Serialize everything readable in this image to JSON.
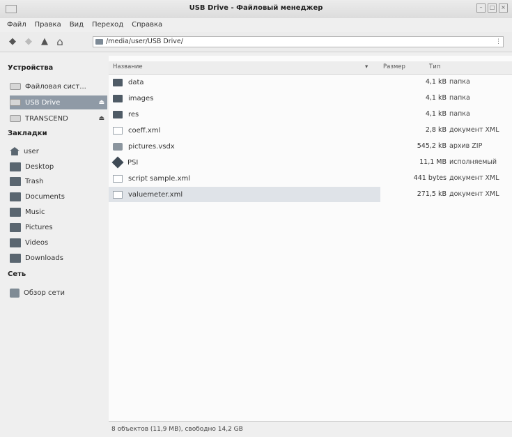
{
  "window": {
    "title": "USB Drive - Файловый менеджер"
  },
  "menu": [
    "Файл",
    "Правка",
    "Вид",
    "Переход",
    "Справка"
  ],
  "toolbar": {
    "path": "/media/user/USB Drive/",
    "icons": [
      "back-icon",
      "forward-icon",
      "up-icon",
      "home-icon"
    ]
  },
  "sidebar": {
    "devices_heading": "Устройства",
    "devices": [
      {
        "label": "Файловая сист...",
        "icon": "drive-icon"
      },
      {
        "label": "USB Drive",
        "icon": "drive-icon",
        "selected": true,
        "eject": "⏏"
      },
      {
        "label": "TRANSCEND",
        "icon": "drive-icon",
        "eject": "⏏"
      }
    ],
    "bookmarks_heading": "Закладки",
    "bookmarks": [
      {
        "label": "user",
        "icon": "home-icon"
      },
      {
        "label": "Desktop",
        "icon": "folder-icon"
      },
      {
        "label": "Trash",
        "icon": "trash-icon"
      },
      {
        "label": "Documents",
        "icon": "folder-icon"
      },
      {
        "label": "Music",
        "icon": "folder-icon"
      },
      {
        "label": "Pictures",
        "icon": "folder-icon"
      },
      {
        "label": "Videos",
        "icon": "folder-icon"
      },
      {
        "label": "Downloads",
        "icon": "folder-icon"
      }
    ],
    "network_heading": "Сеть",
    "network": [
      {
        "label": "Обзор сети",
        "icon": "network-icon"
      }
    ]
  },
  "table": {
    "headers": {
      "name": "Название",
      "size": "Размер",
      "type": "Тип",
      "sort": "▾"
    },
    "rows": [
      {
        "name": "data",
        "size": "4,1 kB",
        "type": "папка",
        "icon": "folder"
      },
      {
        "name": "images",
        "size": "4,1 kB",
        "type": "папка",
        "icon": "folder"
      },
      {
        "name": "res",
        "size": "4,1 kB",
        "type": "папка",
        "icon": "folder"
      },
      {
        "name": "coeff.xml",
        "size": "2,8 kB",
        "type": "документ XML",
        "icon": "file"
      },
      {
        "name": "pictures.vsdx",
        "size": "545,2 kB",
        "type": "архив ZIP",
        "icon": "archive"
      },
      {
        "name": "PSI",
        "size": "11,1 MB",
        "type": "исполняемый",
        "icon": "exec"
      },
      {
        "name": "script sample.xml",
        "size": "441 bytes",
        "type": "документ XML",
        "icon": "file"
      },
      {
        "name": "valuemeter.xml",
        "size": "271,5 kB",
        "type": "документ XML",
        "icon": "file",
        "selected": true
      }
    ]
  },
  "status": {
    "text": "8 объектов (11,9 MB), свободно 14,2 GB"
  }
}
